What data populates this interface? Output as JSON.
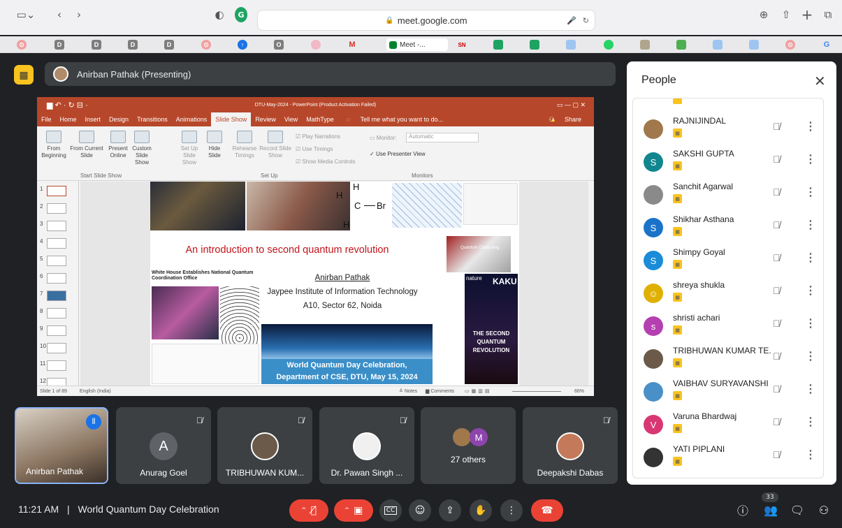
{
  "browser": {
    "url": "meet.google.com",
    "bookmarks": [
      "D",
      "D",
      "D",
      "D",
      "O",
      "M",
      "Meet -...",
      "SN",
      "G"
    ]
  },
  "presenter_banner": "Anirban Pathak (Presenting)",
  "powerpoint": {
    "title": "DTU-May-2024 - PowerPoint (Product Activation Failed)",
    "tabs": [
      "File",
      "Home",
      "Insert",
      "Design",
      "Transitions",
      "Animations",
      "Slide Show",
      "Review",
      "View",
      "MathType"
    ],
    "tell_me": "Tell me what you want to do...",
    "share": "Share",
    "ribbon": {
      "from_beginning": "From Beginning",
      "from_current": "From Current Slide",
      "present_online": "Present Online",
      "custom_show": "Custom Slide Show",
      "group_start": "Start Slide Show",
      "setup_show": "Set Up Slide Show",
      "hide_slide": "Hide Slide",
      "rehearse": "Rehearse Timings",
      "record": "Record Slide Show",
      "play_narrations": "Play Narrations",
      "use_timings": "Use Timings",
      "show_media": "Show Media Controls",
      "group_setup": "Set Up",
      "monitor_label": "Monitor:",
      "monitor_value": "Automatic",
      "presenter_view": "Use Presenter View",
      "group_monitors": "Monitors"
    },
    "thumb_numbers": [
      "1",
      "2",
      "3",
      "4",
      "5",
      "6",
      "7",
      "8",
      "9",
      "10",
      "11",
      "12"
    ],
    "status": {
      "slide_count": "Slide 1 of 89",
      "language": "English (India)",
      "notes": "Notes",
      "comments": "Comments",
      "zoom": "66%"
    },
    "slide": {
      "title": "An introduction to second quantum revolution",
      "author": "Anirban Pathak",
      "institute": "Jaypee Institute of Information Technology",
      "address": "A10, Sector 62, Noida",
      "white_house": "White House Establishes National Quantum Coordination Office",
      "caption_line1": "World Quantum Day Celebration,",
      "caption_line2": "Department of CSE, DTU, May 15, 2024",
      "molecule_h": "H",
      "molecule_c": "C",
      "molecule_br": "Br",
      "nature": "nature",
      "kaku": "KAKU",
      "book": "THE SECOND QUANTUM REVOLUTION",
      "qc": "Quantum Computing"
    }
  },
  "people": {
    "title": "People",
    "participants": [
      {
        "name": "RAJNIJINDAL",
        "initial": "",
        "color": "#a0784c"
      },
      {
        "name": "SAKSHI GUPTA",
        "initial": "S",
        "color": "#12868f"
      },
      {
        "name": "Sanchit Agarwal",
        "initial": "",
        "color": "#8a8a8a"
      },
      {
        "name": "Shikhar Asthana",
        "initial": "S",
        "color": "#1a73c8"
      },
      {
        "name": "Shimpy Goyal",
        "initial": "S",
        "color": "#1a8cd8"
      },
      {
        "name": "shreya shukla",
        "initial": "",
        "color": "#e0b000"
      },
      {
        "name": "shristi achari",
        "initial": "s",
        "color": "#b43fb0"
      },
      {
        "name": "TRIBHUWAN KUMAR TE...",
        "initial": "",
        "color": "#6b5a4a"
      },
      {
        "name": "VAIBHAV SURYAVANSHI",
        "initial": "",
        "color": "#4a90c8"
      },
      {
        "name": "Varuna Bhardwaj",
        "initial": "V",
        "color": "#d93674"
      },
      {
        "name": "YATI PIPLANI",
        "initial": "",
        "color": "#333333"
      }
    ]
  },
  "tiles": [
    {
      "name": "Anirban Pathak"
    },
    {
      "name": "Anurag Goel",
      "initial": "A"
    },
    {
      "name": "TRIBHUWAN KUM..."
    },
    {
      "name": "Dr. Pawan Singh ..."
    },
    {
      "name": "27 others",
      "initial": "M"
    },
    {
      "name": "Deepakshi Dabas"
    }
  ],
  "bottom": {
    "time": "11:21 AM",
    "separator": "|",
    "meeting_name": "World Quantum Day Celebration",
    "participant_count": "33"
  }
}
